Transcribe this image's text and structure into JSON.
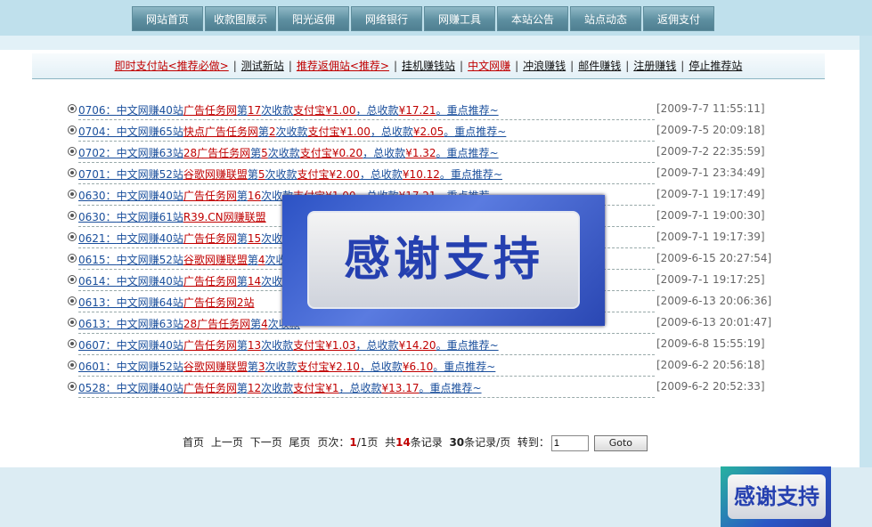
{
  "nav": [
    "网站首页",
    "收款图展示",
    "阳光返佣",
    "网络银行",
    "网赚工具",
    "本站公告",
    "站点动态",
    "返佣支付"
  ],
  "subnav": [
    {
      "label": "即时支付站<推荐必做>",
      "red": true
    },
    {
      "label": "测试新站",
      "red": false
    },
    {
      "label": "推荐返佣站<推荐>",
      "red": true
    },
    {
      "label": "挂机赚钱站",
      "red": false
    },
    {
      "label": "中文网赚",
      "red": true
    },
    {
      "label": "冲浪赚钱",
      "red": false
    },
    {
      "label": "邮件赚钱",
      "red": false
    },
    {
      "label": "注册赚钱",
      "red": false
    },
    {
      "label": "停止推荐站",
      "red": false
    }
  ],
  "items": [
    {
      "code": "0706",
      "site": "中文网赚40站",
      "net": "广告任务网",
      "count": "17",
      "pay": "¥1.00",
      "total": "¥17.21",
      "date": "[2009-7-7 11:55:11]"
    },
    {
      "code": "0704",
      "site": "中文网赚65站",
      "net": "快点广告任务网",
      "count": "2",
      "pay": "¥1.00",
      "total": "¥2.05",
      "date": "[2009-7-5 20:09:18]"
    },
    {
      "code": "0702",
      "site": "中文网赚63站",
      "net": "28广告任务网",
      "count": "5",
      "pay": "¥0.20",
      "total": "¥1.32",
      "date": "[2009-7-2 22:35:59]"
    },
    {
      "code": "0701",
      "site": "中文网赚52站",
      "net": "谷歌网赚联盟",
      "count": "5",
      "pay": "¥2.00",
      "total": "¥10.12",
      "date": "[2009-7-1 23:34:49]"
    },
    {
      "code": "0630",
      "site": "中文网赚40站",
      "net": "广告任务网",
      "count": "16",
      "pay": "¥1.00",
      "total": "¥17.21",
      "date": "[2009-7-1 19:17:49]"
    },
    {
      "code": "0630",
      "site": "中文网赚61站",
      "net": "R39.CN网赚联盟",
      "count": "",
      "pay": "",
      "total": "",
      "date": "[2009-7-1 19:00:30]"
    },
    {
      "code": "0621",
      "site": "中文网赚40站",
      "net": "广告任务网",
      "count": "15",
      "pay": "",
      "total": "",
      "date": "[2009-7-1 19:17:39]"
    },
    {
      "code": "0615",
      "site": "中文网赚52站",
      "net": "谷歌网赚联盟",
      "count": "4",
      "pay": "",
      "total": "",
      "date": "[2009-6-15 20:27:54]"
    },
    {
      "code": "0614",
      "site": "中文网赚40站",
      "net": "广告任务网",
      "count": "14",
      "pay": "",
      "total": "",
      "date": "[2009-7-1 19:17:25]"
    },
    {
      "code": "0613",
      "site": "中文网赚64站",
      "net": "广告任务网2站",
      "count": "",
      "pay": "",
      "total": "",
      "date": "[2009-6-13 20:06:36]"
    },
    {
      "code": "0613",
      "site": "中文网赚63站",
      "net": "28广告任务网",
      "count": "4",
      "pay": "",
      "total": "",
      "date": "[2009-6-13 20:01:47]"
    },
    {
      "code": "0607",
      "site": "中文网赚40站",
      "net": "广告任务网",
      "count": "13",
      "pay": "¥1.03",
      "total": "¥14.20",
      "date": "[2009-6-8 15:55:19]"
    },
    {
      "code": "0601",
      "site": "中文网赚52站",
      "net": "谷歌网赚联盟",
      "count": "3",
      "pay": "¥2.10",
      "total": "¥6.10",
      "date": "[2009-6-2 20:56:18]"
    },
    {
      "code": "0528",
      "site": "中文网赚40站",
      "net": "广告任务网",
      "count": "12",
      "pay": "¥1",
      "total": "¥13.17",
      "date": "[2009-6-2 20:52:33]"
    }
  ],
  "text": {
    "di": "第",
    "times": "次收款",
    "paybrand": "支付宝",
    "totalprefix": "，总收款",
    "suffix": "。重点推荐~"
  },
  "pager": {
    "first": "首页",
    "prev": "上一页",
    "next": "下一页",
    "last": "尾页",
    "page_label": "页次：",
    "page_current": "1",
    "page_total": "/1页",
    "total_prefix": "共",
    "total_count": "14",
    "total_suffix": "条记录",
    "per_count": "30",
    "per_suffix": "条记录/页",
    "goto_label": "转到：",
    "goto_value": "1",
    "goto_button": "Goto"
  },
  "popup": {
    "label": "感谢支持"
  },
  "badge": {
    "label": "感谢支持"
  }
}
